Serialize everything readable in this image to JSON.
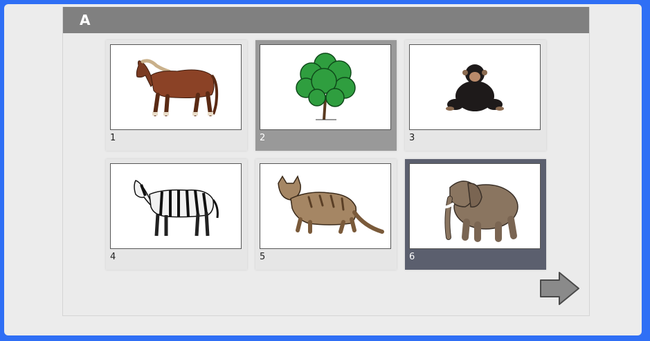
{
  "header": {
    "title": "A"
  },
  "cards": [
    {
      "number": "1",
      "image": "horse"
    },
    {
      "number": "2",
      "image": "tree"
    },
    {
      "number": "3",
      "image": "chimpanzee"
    },
    {
      "number": "4",
      "image": "zebra"
    },
    {
      "number": "5",
      "image": "cat"
    },
    {
      "number": "6",
      "image": "elephant"
    }
  ],
  "states": {
    "hovered_card": "2",
    "selected_card": "6"
  },
  "navigation": {
    "next_icon": "right-arrow-icon"
  },
  "colors": {
    "page_border": "#2f6ff5",
    "header_bg": "#808080",
    "hover_card_bg": "#999999",
    "selected_card_bg": "#5b5f6e"
  }
}
